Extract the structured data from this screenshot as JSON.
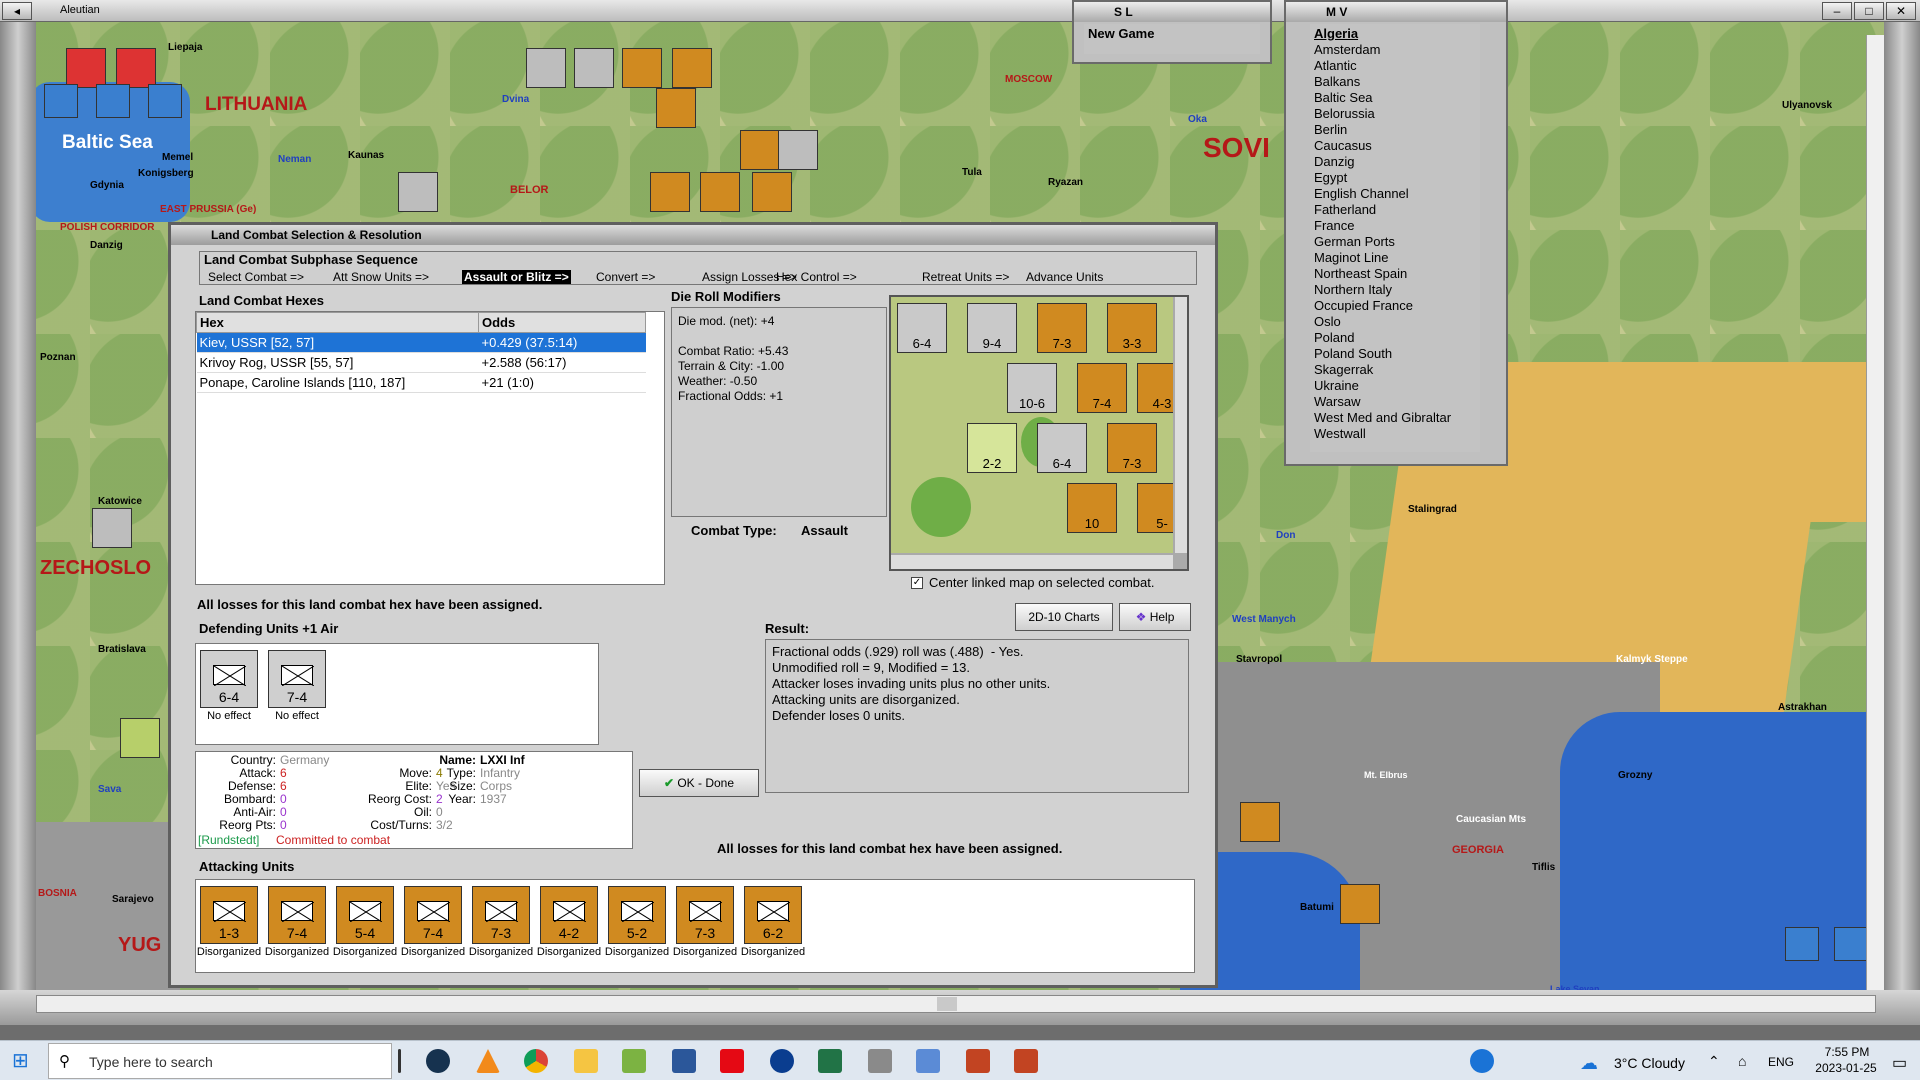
{
  "app": {
    "window_title": "Aleutian"
  },
  "map": {
    "labels": [
      {
        "text": "LITHUANIA",
        "color": "#b51818"
      },
      {
        "text": "Baltic Sea",
        "color": "#ffffff"
      },
      {
        "text": "SOVI",
        "color": "#b51818"
      },
      {
        "text": "MOSCOW",
        "color": "#b51818"
      },
      {
        "text": "ZECHOSLO",
        "color": "#b51818"
      },
      {
        "text": "YUG",
        "color": "#b51818"
      },
      {
        "text": "Stalingrad",
        "color": "#000000"
      },
      {
        "text": "Astrakhan",
        "color": "#000000"
      },
      {
        "text": "Stavropol",
        "color": "#000000"
      },
      {
        "text": "Kalmyk Steppe",
        "color": "#ffffff"
      },
      {
        "text": "GEORGIA",
        "color": "#b51818"
      },
      {
        "text": "Tiflis",
        "color": "#000000"
      },
      {
        "text": "Batumi",
        "color": "#000000"
      },
      {
        "text": "Grozny",
        "color": "#000000"
      },
      {
        "text": "Ulyanovsk",
        "color": "#000000"
      },
      {
        "text": "Tula",
        "color": "#000000"
      },
      {
        "text": "Ryazan",
        "color": "#000000"
      },
      {
        "text": "Kaunas",
        "color": "#000000"
      },
      {
        "text": "Gdynia",
        "color": "#000000"
      },
      {
        "text": "Konigsberg",
        "color": "#000000"
      },
      {
        "text": "Danzig",
        "color": "#000000"
      },
      {
        "text": "Memel",
        "color": "#000000"
      },
      {
        "text": "Liepaja",
        "color": "#000000"
      },
      {
        "text": "Bratislava",
        "color": "#000000"
      },
      {
        "text": "Sarajevo",
        "color": "#000000"
      },
      {
        "text": "BOSNIA",
        "color": "#b51818"
      },
      {
        "text": "POLISH CORRIDOR",
        "color": "#b51818"
      },
      {
        "text": "EAST PRUSSIA (Ge)",
        "color": "#b51818"
      },
      {
        "text": "BELOR",
        "color": "#b51818"
      },
      {
        "text": "Dvina",
        "color": "#2040c0"
      },
      {
        "text": "Neman",
        "color": "#2040c0"
      },
      {
        "text": "Oka",
        "color": "#2040c0"
      },
      {
        "text": "Don",
        "color": "#2040c0"
      },
      {
        "text": "West Manych",
        "color": "#2040c0"
      },
      {
        "text": "Sava",
        "color": "#2040c0"
      },
      {
        "text": "Mt. Elbrus",
        "color": "#ffffff"
      },
      {
        "text": "Caucasian Mts",
        "color": "#ffffff"
      },
      {
        "text": "Lake Sevan",
        "color": "#2040c0"
      },
      {
        "text": "Poznan",
        "color": "#000000"
      },
      {
        "text": "Katowice",
        "color": "#000000"
      }
    ]
  },
  "sl_window": {
    "title": "S L",
    "item": "New Game"
  },
  "mv_window": {
    "title": "M V",
    "items": [
      "Algeria",
      "Amsterdam",
      "Atlantic",
      "Balkans",
      "Baltic Sea",
      "Belorussia",
      "Berlin",
      "Caucasus",
      "Danzig",
      "Egypt",
      "English Channel",
      "Fatherland",
      "France",
      "German Ports",
      "Maginot Line",
      "Northeast Spain",
      "Northern Italy",
      "Occupied France",
      "Oslo",
      "Poland",
      "Poland South",
      "Skagerrak",
      "Ukraine",
      "Warsaw",
      "West Med and Gibraltar",
      "Westwall"
    ]
  },
  "dialog": {
    "title": "Land Combat Selection & Resolution",
    "subphase_title": "Land Combat Subphase Sequence",
    "steps": [
      "Select Combat =>",
      "Att Snow Units =>",
      "Assault or Blitz =>",
      "Convert =>",
      "Assign Losses =>",
      "Hex Control =>",
      "Retreat Units =>",
      "Advance Units"
    ],
    "hexes_title": "Land Combat Hexes",
    "hex_col": "Hex",
    "odds_col": "Odds",
    "rows": [
      {
        "hex": "Kiev, USSR [52, 57]",
        "odds": "+0.429 (37.5:14)"
      },
      {
        "hex": "Krivoy Rog, USSR [55, 57]",
        "odds": "+2.588 (56:17)"
      },
      {
        "hex": "Ponape, Caroline Islands [110, 187]",
        "odds": "+21 (1:0)"
      }
    ],
    "drm_title": "Die Roll Modifiers",
    "drm_lines": [
      "Die mod. (net): +4",
      "",
      "Combat Ratio: +5.43",
      "Terrain & City: -1.00",
      "Weather: -0.50",
      "Fractional Odds: +1"
    ],
    "combat_type_label": "Combat Type:",
    "combat_type": "Assault",
    "center_map": "Center linked map on selected combat.",
    "charts_btn": "2D-10 Charts",
    "help_btn": "Help",
    "losses_msg": "All losses for this land combat hex have been assigned.",
    "result_title": "Result:",
    "result_lines": [
      "Fractional odds (.929) roll was (.488)  - Yes.",
      "Unmodified roll = 9, Modified = 13.",
      "Attacker loses invading units plus no other units.",
      "Attacking units are disorganized.",
      "Defender loses 0 units."
    ],
    "defending_title": "Defending Units +1 Air",
    "defenders": [
      {
        "value": "6-4",
        "status": "No effect"
      },
      {
        "value": "7-4",
        "status": "No effect"
      }
    ],
    "ok_btn": "OK - Done",
    "info": {
      "country_l": "Country:",
      "country": "Germany",
      "attack_l": "Attack:",
      "attack": "6",
      "defense_l": "Defense:",
      "defense": "6",
      "bombard_l": "Bombard:",
      "bombard": "0",
      "antiair_l": "Anti-Air:",
      "antiair": "0",
      "reorg_l": "Reorg Pts:",
      "reorg": "0",
      "move_l": "Move:",
      "move": "4",
      "elite_l": "Elite:",
      "elite": "Yes",
      "reorgcost_l": "Reorg Cost:",
      "reorgcost": "2",
      "oil_l": "Oil:",
      "oil": "0",
      "cost_l": "Cost/Turns:",
      "cost": "3/2",
      "name_l": "Name:",
      "name": "LXXI Inf",
      "type_l": "Type:",
      "type": "Infantry",
      "size_l": "Size:",
      "size": "Corps",
      "year_l": "Year:",
      "year": "1937",
      "hq": "[Rundstedt]",
      "committed": "Committed to combat"
    },
    "attacking_title": "Attacking Units",
    "attackers": [
      {
        "value": "1-3",
        "status": "Disorganized"
      },
      {
        "value": "7-4",
        "status": "Disorganized"
      },
      {
        "value": "5-4",
        "status": "Disorganized"
      },
      {
        "value": "7-4",
        "status": "Disorganized"
      },
      {
        "value": "7-3",
        "status": "Disorganized"
      },
      {
        "value": "4-2",
        "status": "Disorganized"
      },
      {
        "value": "5-2",
        "status": "Disorganized"
      },
      {
        "value": "7-3",
        "status": "Disorganized"
      },
      {
        "value": "6-2",
        "status": "Disorganized"
      }
    ],
    "minimap_counters": [
      "6-4",
      "9-4",
      "7-3",
      "3-3",
      "10-6",
      "7-4",
      "4-3",
      "2-2",
      "6-4",
      "7-3",
      "10",
      "5-"
    ]
  },
  "taskbar": {
    "search_placeholder": "Type here to search",
    "weather": "3°C  Cloudy",
    "lang": "ENG",
    "time": "7:55 PM",
    "date": "2023-01-25"
  },
  "colors": {
    "selection": "#1e73d6",
    "counter_orange": "#d08a20",
    "red_label": "#b51818"
  }
}
